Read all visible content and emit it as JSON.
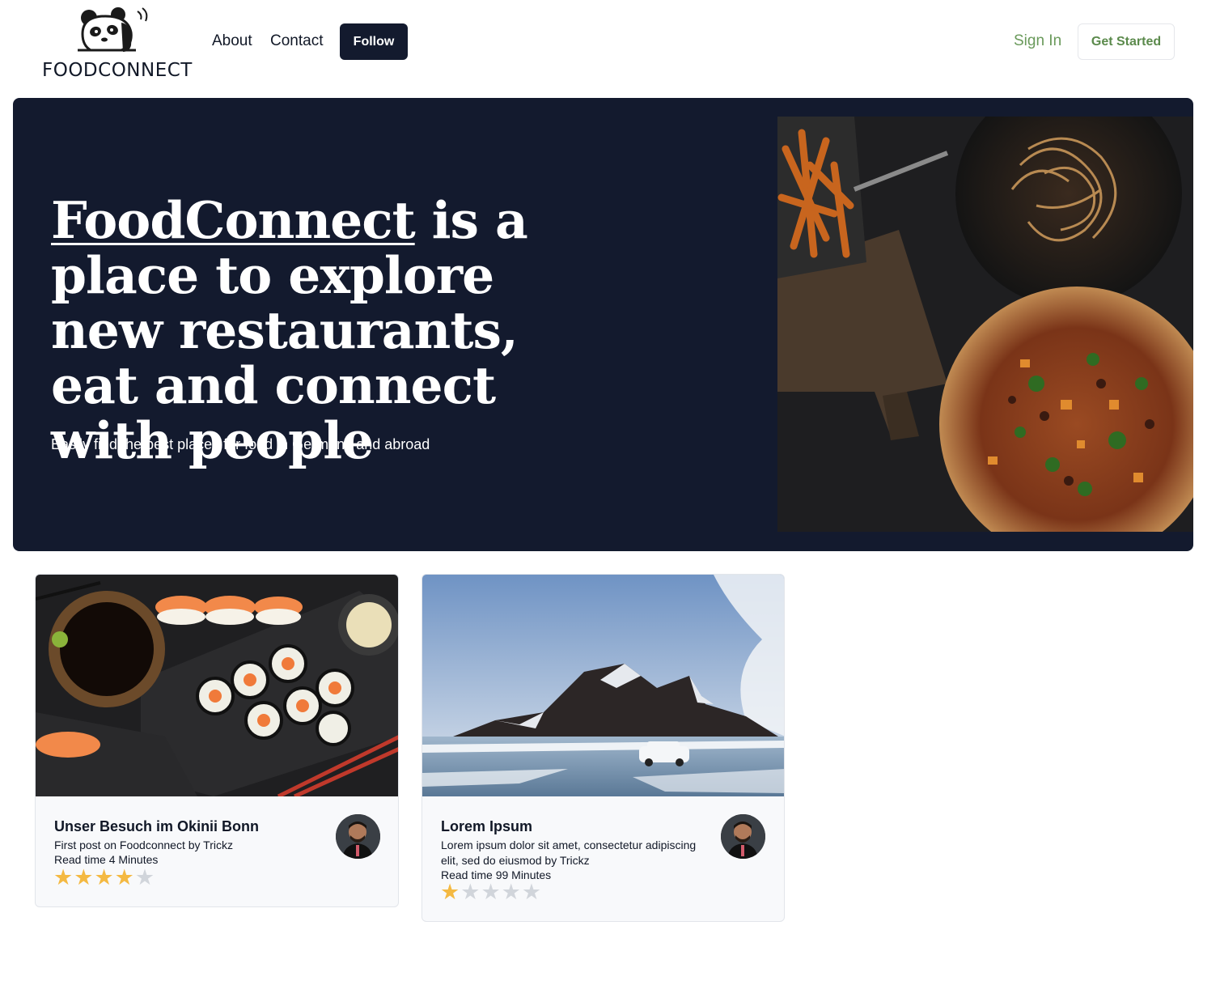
{
  "header": {
    "logo_text": "FOODCONNECT",
    "nav": {
      "about": "About",
      "contact": "Contact"
    },
    "follow_label": "Follow",
    "signin_label": "Sign In",
    "get_started_label": "Get Started"
  },
  "hero": {
    "title_brand": "FoodConnect",
    "title_rest": " is a place to explore new restaurants, eat and connect with people",
    "subtitle": "Easily find the best places for food in Germany and abroad",
    "image_icon": "food-platter-image"
  },
  "posts": [
    {
      "title": "Unser Besuch im Okinii Bonn",
      "description": "First post on Foodconnect by Trickz",
      "read_time": "Read time 4 Minutes",
      "rating": 4,
      "max_rating": 5,
      "image_icon": "sushi-image",
      "avatar_icon": "author-avatar"
    },
    {
      "title": "Lorem Ipsum",
      "description": "Lorem ipsum dolor sit amet, consectetur adipiscing elit, sed do eiusmod by Trickz",
      "read_time": "Read time 99 Minutes",
      "rating": 1,
      "max_rating": 5,
      "image_icon": "mountain-lake-image",
      "avatar_icon": "author-avatar"
    }
  ],
  "colors": {
    "navy": "#131a2e",
    "green": "#6a9a5b",
    "star_on": "#f4b942",
    "star_off": "#d1d5db"
  }
}
